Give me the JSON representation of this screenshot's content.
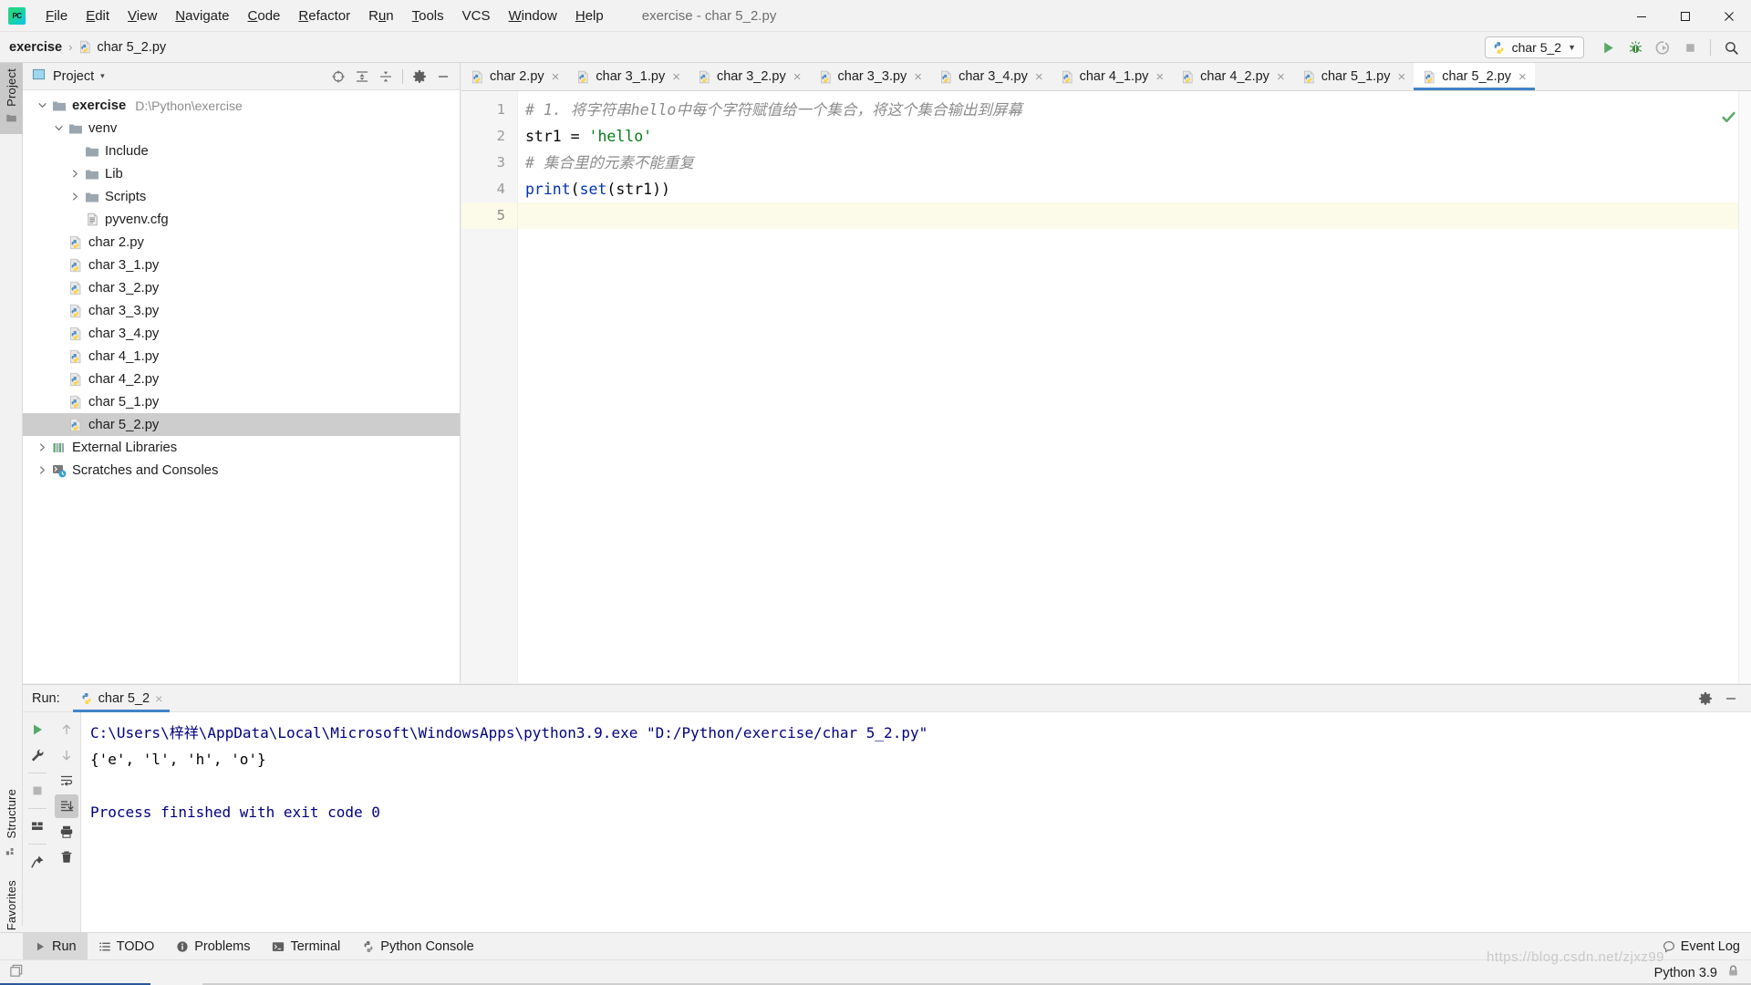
{
  "window": {
    "title": "exercise - char 5_2.py",
    "app_icon": "pycharm-logo-icon",
    "minimize_label": "Minimize",
    "maximize_label": "Maximize",
    "close_label": "Close"
  },
  "menubar": {
    "items": [
      {
        "label": "File",
        "mnemonic": "F"
      },
      {
        "label": "Edit",
        "mnemonic": "E"
      },
      {
        "label": "View",
        "mnemonic": "V"
      },
      {
        "label": "Navigate",
        "mnemonic": "N"
      },
      {
        "label": "Code",
        "mnemonic": "C"
      },
      {
        "label": "Refactor",
        "mnemonic": "R"
      },
      {
        "label": "Run",
        "mnemonic": "u"
      },
      {
        "label": "Tools",
        "mnemonic": "T"
      },
      {
        "label": "VCS",
        "mnemonic": ""
      },
      {
        "label": "Window",
        "mnemonic": "W"
      },
      {
        "label": "Help",
        "mnemonic": "H"
      }
    ]
  },
  "navbar": {
    "breadcrumbs": [
      {
        "label": "exercise",
        "bold": true,
        "icon": ""
      },
      {
        "label": "char 5_2.py",
        "bold": false,
        "icon": "python-file-icon"
      }
    ],
    "separator": "›"
  },
  "toolbar": {
    "run_config": {
      "name": "char 5_2",
      "icon": "python-file-icon",
      "chevron": "▼"
    },
    "buttons": [
      {
        "name": "run-button",
        "icon": "run-play-icon",
        "title": "Run"
      },
      {
        "name": "debug-button",
        "icon": "debug-bug-icon",
        "title": "Debug"
      },
      {
        "name": "run-coverage-button",
        "icon": "run-coverage-icon",
        "title": "Run with Coverage"
      },
      {
        "name": "stop-button",
        "icon": "stop-square-icon",
        "title": "Stop"
      },
      {
        "name": "search-everywhere-button",
        "icon": "search-icon",
        "title": "Search Everywhere"
      }
    ]
  },
  "left_stripe": {
    "items": [
      {
        "label": "Project",
        "icon": "project-folder-icon",
        "active": true
      },
      {
        "label": "Structure",
        "icon": "structure-icon",
        "active": false
      },
      {
        "label": "Favorites",
        "icon": "star-icon",
        "active": false
      }
    ]
  },
  "project_panel": {
    "title": "Project",
    "title_icon": "project-view-icon",
    "chevron": "▾",
    "tools": [
      {
        "name": "select-opened-file-button",
        "icon": "crosshair-target-icon"
      },
      {
        "name": "expand-all-button",
        "icon": "expand-all-icon"
      },
      {
        "name": "collapse-all-button",
        "icon": "collapse-all-icon"
      },
      {
        "name": "settings-button",
        "icon": "gear-icon"
      },
      {
        "name": "hide-button",
        "icon": "minimize-dash-icon"
      }
    ],
    "tree": [
      {
        "label": "exercise",
        "path": "D:\\Python\\exercise",
        "indent": 0,
        "arrow": "expanded",
        "icon": "folder-icon",
        "bold": true,
        "selected": false
      },
      {
        "label": "venv",
        "path": "",
        "indent": 1,
        "arrow": "expanded",
        "icon": "folder-icon",
        "bold": false,
        "selected": false
      },
      {
        "label": "Include",
        "path": "",
        "indent": 2,
        "arrow": "none",
        "icon": "folder-icon",
        "bold": false,
        "selected": false
      },
      {
        "label": "Lib",
        "path": "",
        "indent": 2,
        "arrow": "collapsed",
        "icon": "folder-icon",
        "bold": false,
        "selected": false
      },
      {
        "label": "Scripts",
        "path": "",
        "indent": 2,
        "arrow": "collapsed",
        "icon": "folder-icon",
        "bold": false,
        "selected": false
      },
      {
        "label": "pyvenv.cfg",
        "path": "",
        "indent": 2,
        "arrow": "none",
        "icon": "config-file-icon",
        "bold": false,
        "selected": false
      },
      {
        "label": "char 2.py",
        "path": "",
        "indent": 1,
        "arrow": "none",
        "icon": "python-file-icon",
        "bold": false,
        "selected": false
      },
      {
        "label": "char 3_1.py",
        "path": "",
        "indent": 1,
        "arrow": "none",
        "icon": "python-file-icon",
        "bold": false,
        "selected": false
      },
      {
        "label": "char 3_2.py",
        "path": "",
        "indent": 1,
        "arrow": "none",
        "icon": "python-file-icon",
        "bold": false,
        "selected": false
      },
      {
        "label": "char 3_3.py",
        "path": "",
        "indent": 1,
        "arrow": "none",
        "icon": "python-file-icon",
        "bold": false,
        "selected": false
      },
      {
        "label": "char 3_4.py",
        "path": "",
        "indent": 1,
        "arrow": "none",
        "icon": "python-file-icon",
        "bold": false,
        "selected": false
      },
      {
        "label": "char 4_1.py",
        "path": "",
        "indent": 1,
        "arrow": "none",
        "icon": "python-file-icon",
        "bold": false,
        "selected": false
      },
      {
        "label": "char 4_2.py",
        "path": "",
        "indent": 1,
        "arrow": "none",
        "icon": "python-file-icon",
        "bold": false,
        "selected": false
      },
      {
        "label": "char 5_1.py",
        "path": "",
        "indent": 1,
        "arrow": "none",
        "icon": "python-file-icon",
        "bold": false,
        "selected": false
      },
      {
        "label": "char 5_2.py",
        "path": "",
        "indent": 1,
        "arrow": "none",
        "icon": "python-file-icon",
        "bold": false,
        "selected": true
      },
      {
        "label": "External Libraries",
        "path": "",
        "indent": 0,
        "arrow": "collapsed",
        "icon": "external-libraries-icon",
        "bold": false,
        "selected": false
      },
      {
        "label": "Scratches and Consoles",
        "path": "",
        "indent": 0,
        "arrow": "collapsed",
        "icon": "scratches-icon",
        "bold": false,
        "selected": false
      }
    ]
  },
  "editor": {
    "tabs": [
      {
        "label": "char 2.py",
        "icon": "python-file-icon",
        "active": false
      },
      {
        "label": "char 3_1.py",
        "icon": "python-file-icon",
        "active": false
      },
      {
        "label": "char 3_2.py",
        "icon": "python-file-icon",
        "active": false
      },
      {
        "label": "char 3_3.py",
        "icon": "python-file-icon",
        "active": false
      },
      {
        "label": "char 3_4.py",
        "icon": "python-file-icon",
        "active": false
      },
      {
        "label": "char 4_1.py",
        "icon": "python-file-icon",
        "active": false
      },
      {
        "label": "char 4_2.py",
        "icon": "python-file-icon",
        "active": false
      },
      {
        "label": "char 5_1.py",
        "icon": "python-file-icon",
        "active": false
      },
      {
        "label": "char 5_2.py",
        "icon": "python-file-icon",
        "active": true
      }
    ],
    "tab_close_glyph": "×",
    "line_numbers": [
      "1",
      "2",
      "3",
      "4",
      "5"
    ],
    "current_line": 5,
    "lines": [
      {
        "n": 1,
        "text": "# 1. 将字符串hello中每个字符赋值给一个集合，将这个集合输出到屏幕",
        "kind": "comment"
      },
      {
        "n": 2,
        "text": "str1 = 'hello'",
        "kind": "code"
      },
      {
        "n": 3,
        "text": "# 集合里的元素不能重复",
        "kind": "comment"
      },
      {
        "n": 4,
        "text": "print(set(str1))",
        "kind": "code"
      },
      {
        "n": 5,
        "text": "",
        "kind": "code"
      }
    ],
    "inspection_status": "ok-checkmark-icon"
  },
  "run_panel": {
    "label": "Run:",
    "tab": {
      "label": "char 5_2",
      "icon": "python-file-icon"
    },
    "tab_close_glyph": "×",
    "header_buttons": [
      {
        "name": "run-panel-settings-button",
        "icon": "gear-icon"
      },
      {
        "name": "run-panel-hide-button",
        "icon": "minimize-dash-icon"
      }
    ],
    "side_buttons": [
      {
        "name": "rerun-button",
        "icon": "run-play-icon"
      },
      {
        "name": "edit-configurations-button",
        "icon": "wrench-icon"
      },
      {
        "name": "stop-button",
        "icon": "stop-square-icon"
      },
      {
        "name": "layout-button",
        "icon": "layout-grid-icon"
      },
      {
        "name": "pin-tab-button",
        "icon": "pin-icon"
      }
    ],
    "side_buttons2": [
      {
        "name": "up-stacktrace-button",
        "icon": "arrow-up-icon"
      },
      {
        "name": "down-stacktrace-button",
        "icon": "arrow-down-icon"
      },
      {
        "name": "soft-wrap-button",
        "icon": "soft-wrap-icon"
      },
      {
        "name": "scroll-to-end-button",
        "icon": "scroll-to-end-icon",
        "toggled": true
      },
      {
        "name": "print-button",
        "icon": "printer-icon"
      },
      {
        "name": "clear-all-button",
        "icon": "trash-icon"
      }
    ],
    "console_lines": [
      {
        "text": "C:\\Users\\梓祥\\AppData\\Local\\Microsoft\\WindowsApps\\python3.9.exe \"D:/Python/exercise/char 5_2.py\"",
        "kind": "cmd"
      },
      {
        "text": "{'e', 'l', 'h', 'o'}",
        "kind": "out"
      },
      {
        "text": "",
        "kind": "blank"
      },
      {
        "text": "Process finished with exit code 0",
        "kind": "fin"
      }
    ]
  },
  "statusbar": {
    "items": [
      {
        "label": "Run",
        "icon": "run-play-icon",
        "active": true
      },
      {
        "label": "TODO",
        "icon": "todo-list-icon",
        "active": false
      },
      {
        "label": "Problems",
        "icon": "problems-icon",
        "active": false
      },
      {
        "label": "Terminal",
        "icon": "terminal-icon",
        "active": false
      },
      {
        "label": "Python Console",
        "icon": "python-console-icon",
        "active": false
      }
    ],
    "event_log": {
      "label": "Event Log",
      "icon": "event-log-icon"
    }
  },
  "bottombar": {
    "left_icon": "windows-layout-icon",
    "interpreter": "Python 3.9",
    "lock_icon": "lock-icon"
  },
  "watermark": {
    "text": "https://blog.csdn.net/zjxz99"
  },
  "colors": {
    "accent_blue": "#4083c9",
    "selection_gray": "#cdcdcd",
    "panel_bg": "#f2f2f2",
    "editor_bg": "#ffffff",
    "string_green": "#067d17",
    "keyword_blue": "#0033b3",
    "comment_gray": "#8c8c8c",
    "console_navy": "#000080",
    "current_line": "#fcfae8"
  }
}
